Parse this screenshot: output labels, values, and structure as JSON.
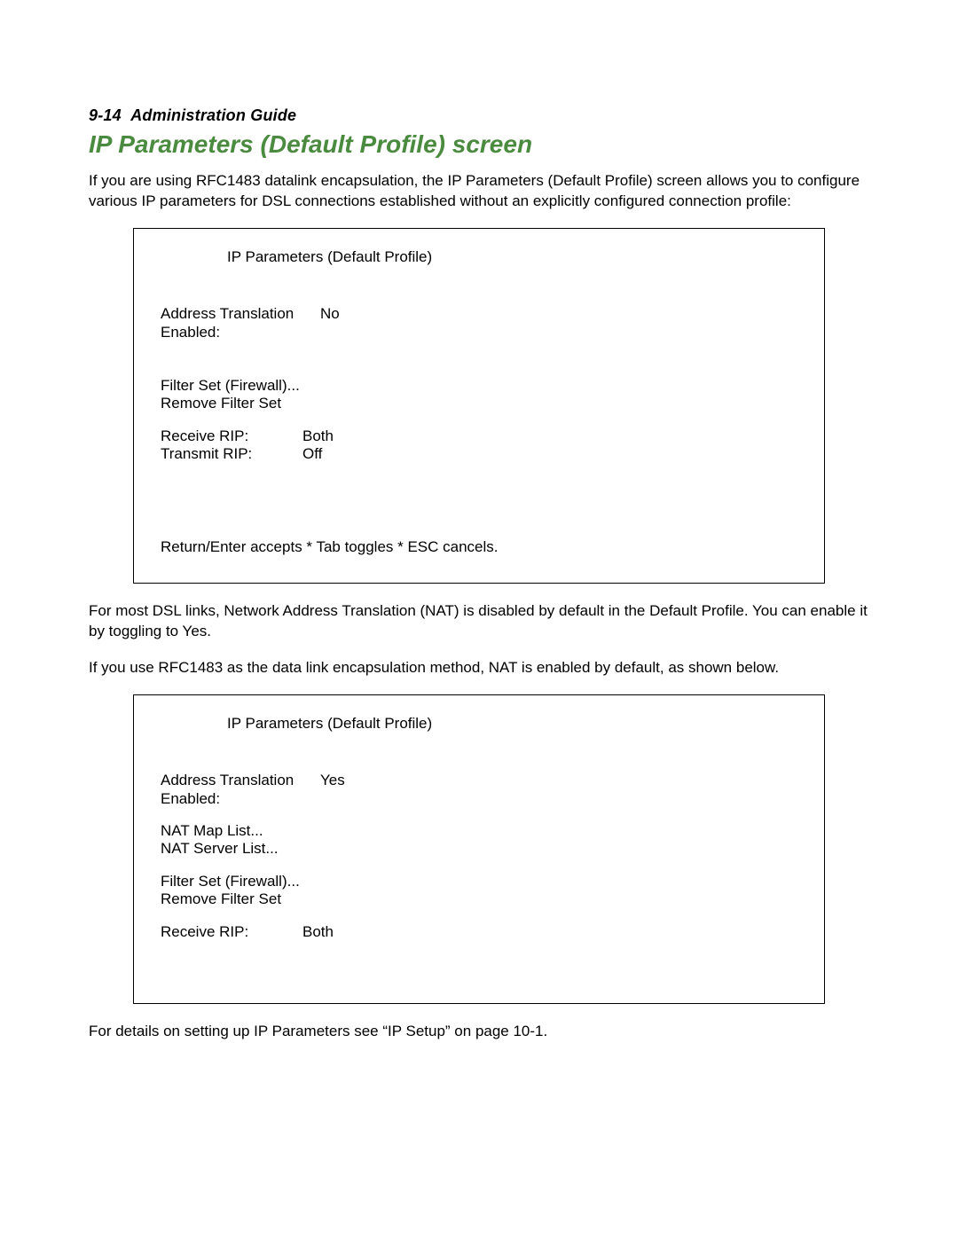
{
  "header": {
    "page_ref": "9-14",
    "guide": "Administration Guide"
  },
  "section_title": "IP Parameters (Default Profile) screen",
  "intro": "If you are using RFC1483 datalink encapsulation, the IP Parameters (Default Profile) screen allows you to configure various IP parameters for DSL connections established without an explicitly configured connection profile:",
  "box1": {
    "title": "IP Parameters (Default Profile)",
    "addr_label": "Address Translation Enabled:",
    "addr_value": "No",
    "filter_set": "Filter Set (Firewall)...",
    "remove_filter": "Remove Filter Set",
    "receive_rip_label": "Receive RIP:",
    "receive_rip_value": "Both",
    "transmit_rip_label": "Transmit RIP:",
    "transmit_rip_value": "Off",
    "footer": "Return/Enter accepts * Tab toggles * ESC cancels."
  },
  "mid1": "For most DSL links, Network Address Translation (NAT) is disabled by default in the Default Profile. You can enable it by toggling to Yes.",
  "mid2": "If you use RFC1483 as the data link encapsulation method, NAT is enabled by default, as shown below.",
  "box2": {
    "title": "IP Parameters (Default Profile)",
    "addr_label": "Address Translation Enabled:",
    "addr_value": "Yes",
    "nat_map": "NAT Map List...",
    "nat_server": "NAT Server List...",
    "filter_set": "Filter Set (Firewall)...",
    "remove_filter": "Remove Filter Set",
    "receive_rip_label": "Receive RIP:",
    "receive_rip_value": "Both"
  },
  "outro": "For details on setting up IP Parameters see “IP Setup” on page 10-1."
}
